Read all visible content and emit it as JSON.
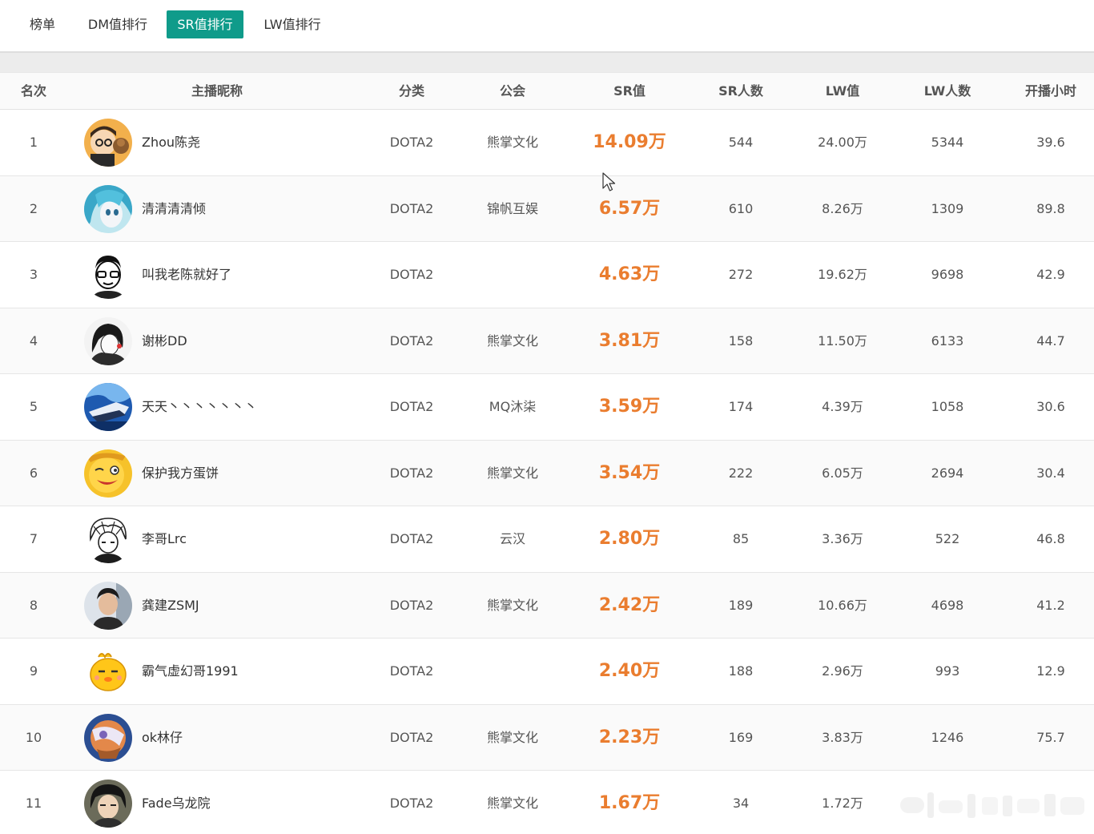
{
  "tabs": [
    {
      "label": "榜单",
      "active": false
    },
    {
      "label": "DM值排行",
      "active": false
    },
    {
      "label": "SR值排行",
      "active": true
    },
    {
      "label": "LW值排行",
      "active": false
    }
  ],
  "colors": {
    "accent": "#0f9b8a",
    "sr_value": "#ea7d2f"
  },
  "table": {
    "headers": [
      "名次",
      "主播昵称",
      "分类",
      "公会",
      "SR值",
      "SR人数",
      "LW值",
      "LW人数",
      "开播小时"
    ],
    "rows": [
      {
        "rank": "1",
        "name": "Zhou陈尧",
        "category": "DOTA2",
        "guild": "熊掌文化",
        "sr": "14.09万",
        "sr_count": "544",
        "lw": "24.00万",
        "lw_count": "5344",
        "hours": "39.6",
        "avatar": "cartoon-glasses-avatar"
      },
      {
        "rank": "2",
        "name": "清清清清倾",
        "category": "DOTA2",
        "guild": "锦帆互娱",
        "sr": "6.57万",
        "sr_count": "610",
        "lw": "8.26万",
        "lw_count": "1309",
        "hours": "89.8",
        "avatar": "anime-blue-hair-avatar"
      },
      {
        "rank": "3",
        "name": "叫我老陈就好了",
        "category": "DOTA2",
        "guild": "",
        "sr": "4.63万",
        "sr_count": "272",
        "lw": "19.62万",
        "lw_count": "9698",
        "hours": "42.9",
        "avatar": "sketch-glasses-man-avatar"
      },
      {
        "rank": "4",
        "name": "谢彬DD",
        "category": "DOTA2",
        "guild": "熊掌文化",
        "sr": "3.81万",
        "sr_count": "158",
        "lw": "11.50万",
        "lw_count": "6133",
        "hours": "44.7",
        "avatar": "manga-girl-avatar"
      },
      {
        "rank": "5",
        "name": "天天丶丶丶丶丶丶丶",
        "category": "DOTA2",
        "guild": "MQ沐柒",
        "sr": "3.59万",
        "sr_count": "174",
        "lw": "4.39万",
        "lw_count": "1058",
        "hours": "30.6",
        "avatar": "blue-scene-avatar"
      },
      {
        "rank": "6",
        "name": "保护我方蛋饼",
        "category": "DOTA2",
        "guild": "熊掌文化",
        "sr": "3.54万",
        "sr_count": "222",
        "lw": "6.05万",
        "lw_count": "2694",
        "hours": "30.4",
        "avatar": "yellow-wink-cartoon-avatar"
      },
      {
        "rank": "7",
        "name": "李哥Lrc",
        "category": "DOTA2",
        "guild": "云汉",
        "sr": "2.80万",
        "sr_count": "85",
        "lw": "3.36万",
        "lw_count": "522",
        "hours": "46.8",
        "avatar": "lineart-anime-boy-avatar"
      },
      {
        "rank": "8",
        "name": "龚建ZSMJ",
        "category": "DOTA2",
        "guild": "熊掌文化",
        "sr": "2.42万",
        "sr_count": "189",
        "lw": "10.66万",
        "lw_count": "4698",
        "hours": "41.2",
        "avatar": "man-photo-avatar"
      },
      {
        "rank": "9",
        "name": "霸气虚幻哥1991",
        "category": "DOTA2",
        "guild": "",
        "sr": "2.40万",
        "sr_count": "188",
        "lw": "2.96万",
        "lw_count": "993",
        "hours": "12.9",
        "avatar": "yellow-chick-avatar"
      },
      {
        "rank": "10",
        "name": "ok林仔",
        "category": "DOTA2",
        "guild": "熊掌文化",
        "sr": "2.23万",
        "sr_count": "169",
        "lw": "3.83万",
        "lw_count": "1246",
        "hours": "75.7",
        "avatar": "blue-orange-game-avatar"
      },
      {
        "rank": "11",
        "name": "Fade乌龙院",
        "category": "DOTA2",
        "guild": "熊掌文化",
        "sr": "1.67万",
        "sr_count": "34",
        "lw": "1.72万",
        "lw_count": "",
        "hours": "",
        "avatar": "dark-hair-anime-avatar"
      }
    ]
  }
}
